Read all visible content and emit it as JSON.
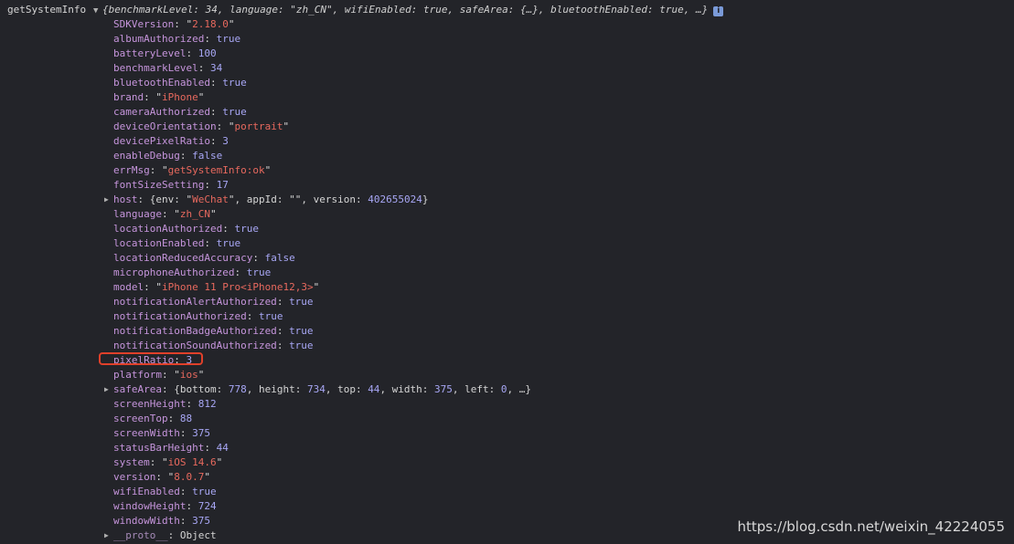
{
  "log_label": "getSystemInfo",
  "summary": "{benchmarkLevel: 34, language: \"zh_CN\", wifiEnabled: true, safeArea: {…}, bluetoothEnabled: true, …}",
  "info_badge": "i",
  "properties": [
    {
      "key": "SDKVersion",
      "value": "2.18.0",
      "type": "string"
    },
    {
      "key": "albumAuthorized",
      "value": "true",
      "type": "bool"
    },
    {
      "key": "batteryLevel",
      "value": "100",
      "type": "num"
    },
    {
      "key": "benchmarkLevel",
      "value": "34",
      "type": "num"
    },
    {
      "key": "bluetoothEnabled",
      "value": "true",
      "type": "bool"
    },
    {
      "key": "brand",
      "value": "iPhone",
      "type": "string"
    },
    {
      "key": "cameraAuthorized",
      "value": "true",
      "type": "bool"
    },
    {
      "key": "deviceOrientation",
      "value": "portrait",
      "type": "string"
    },
    {
      "key": "devicePixelRatio",
      "value": "3",
      "type": "num"
    },
    {
      "key": "enableDebug",
      "value": "false",
      "type": "bool"
    },
    {
      "key": "errMsg",
      "value": "getSystemInfo:ok",
      "type": "string"
    },
    {
      "key": "fontSizeSetting",
      "value": "17",
      "type": "num"
    },
    {
      "key": "host",
      "value": "",
      "type": "host",
      "expandable": true
    },
    {
      "key": "language",
      "value": "zh_CN",
      "type": "string"
    },
    {
      "key": "locationAuthorized",
      "value": "true",
      "type": "bool"
    },
    {
      "key": "locationEnabled",
      "value": "true",
      "type": "bool"
    },
    {
      "key": "locationReducedAccuracy",
      "value": "false",
      "type": "bool"
    },
    {
      "key": "microphoneAuthorized",
      "value": "true",
      "type": "bool"
    },
    {
      "key": "model",
      "value": "iPhone 11 Pro<iPhone12,3>",
      "type": "string"
    },
    {
      "key": "notificationAlertAuthorized",
      "value": "true",
      "type": "bool"
    },
    {
      "key": "notificationAuthorized",
      "value": "true",
      "type": "bool"
    },
    {
      "key": "notificationBadgeAuthorized",
      "value": "true",
      "type": "bool"
    },
    {
      "key": "notificationSoundAuthorized",
      "value": "true",
      "type": "bool"
    },
    {
      "key": "pixelRatio",
      "value": "3",
      "type": "num",
      "highlighted": true
    },
    {
      "key": "platform",
      "value": "ios",
      "type": "string"
    },
    {
      "key": "safeArea",
      "value": "",
      "type": "safearea",
      "expandable": true
    },
    {
      "key": "screenHeight",
      "value": "812",
      "type": "num"
    },
    {
      "key": "screenTop",
      "value": "88",
      "type": "num"
    },
    {
      "key": "screenWidth",
      "value": "375",
      "type": "num"
    },
    {
      "key": "statusBarHeight",
      "value": "44",
      "type": "num"
    },
    {
      "key": "system",
      "value": "iOS 14.6",
      "type": "string"
    },
    {
      "key": "version",
      "value": "8.0.7",
      "type": "string"
    },
    {
      "key": "wifiEnabled",
      "value": "true",
      "type": "bool"
    },
    {
      "key": "windowHeight",
      "value": "724",
      "type": "num"
    },
    {
      "key": "windowWidth",
      "value": "375",
      "type": "num"
    },
    {
      "key": "__proto__",
      "value": "Object",
      "type": "obj",
      "expandable": true,
      "proto": true
    }
  ],
  "host": {
    "env": "WeChat",
    "appId": "",
    "version": "402655024"
  },
  "safe_area": {
    "bottom": "778",
    "height": "734",
    "top": "44",
    "width": "375",
    "left": "0",
    "more": "…"
  },
  "watermark": "https://blog.csdn.net/weixin_42224055",
  "colors": {
    "background": "#232429",
    "key": "#c695dc",
    "string": "#e8695e",
    "number": "#a8a7f5",
    "highlight_border": "#e0402a"
  }
}
